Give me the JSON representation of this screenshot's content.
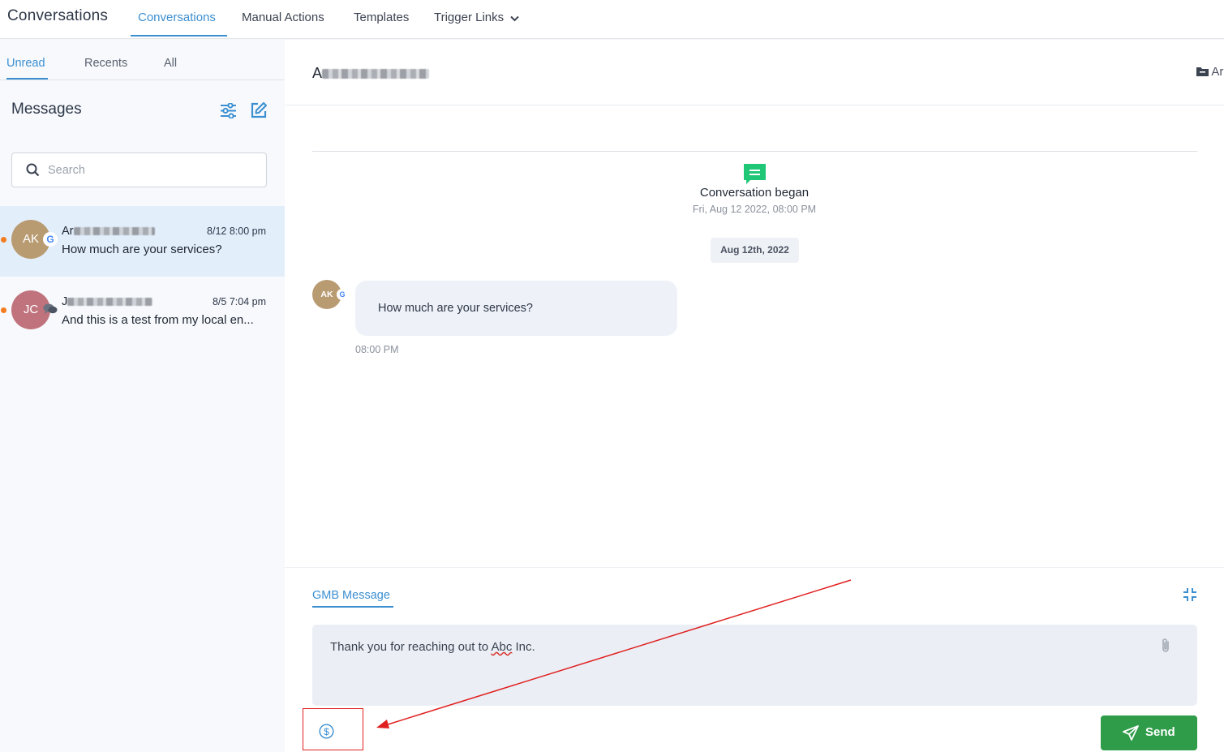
{
  "topnav": {
    "app_title": "Conversations",
    "tabs": [
      {
        "label": "Conversations",
        "active": true
      },
      {
        "label": "Manual Actions",
        "active": false
      },
      {
        "label": "Templates",
        "active": false
      },
      {
        "label": "Trigger Links",
        "active": false
      }
    ]
  },
  "sidebar": {
    "tabs": [
      {
        "label": "Unread",
        "active": true
      },
      {
        "label": "Recents",
        "active": false
      },
      {
        "label": "All",
        "active": false
      }
    ],
    "title": "Messages",
    "search": {
      "placeholder": "Search",
      "value": ""
    },
    "conversations": [
      {
        "initials": "AK",
        "name_prefix": "Ar",
        "time": "8/12 8:00 pm",
        "preview": "How much are your services?",
        "channel": "google",
        "avatar_color": "#b99b72",
        "selected": true,
        "unread": true
      },
      {
        "initials": "JC",
        "name_prefix": "J",
        "time": "8/5 7:04 pm",
        "preview": "And this is a test from my local en...",
        "channel": "chat",
        "avatar_color": "#c0737d",
        "selected": false,
        "unread": true
      }
    ]
  },
  "chat": {
    "header_name_prefix": "A",
    "header_right": "Ar",
    "began_label": "Conversation began",
    "began_date": "Fri, Aug 12 2022, 08:00 PM",
    "date_chip": "Aug 12th, 2022",
    "messages": [
      {
        "avatar": "AK",
        "text": "How much are your services?",
        "time": "08:00 PM"
      }
    ]
  },
  "composer": {
    "tab_label": "GMB Message",
    "text_before": "Thank you for reaching out to ",
    "text_spell": "Abc",
    "text_after": " Inc.",
    "send_label": "Send"
  },
  "colors": {
    "accent": "#3b8fd1",
    "send": "#2e9c48",
    "unread_dot": "#f47c20",
    "began_icon": "#1fc776",
    "annotation": "#e02020"
  }
}
